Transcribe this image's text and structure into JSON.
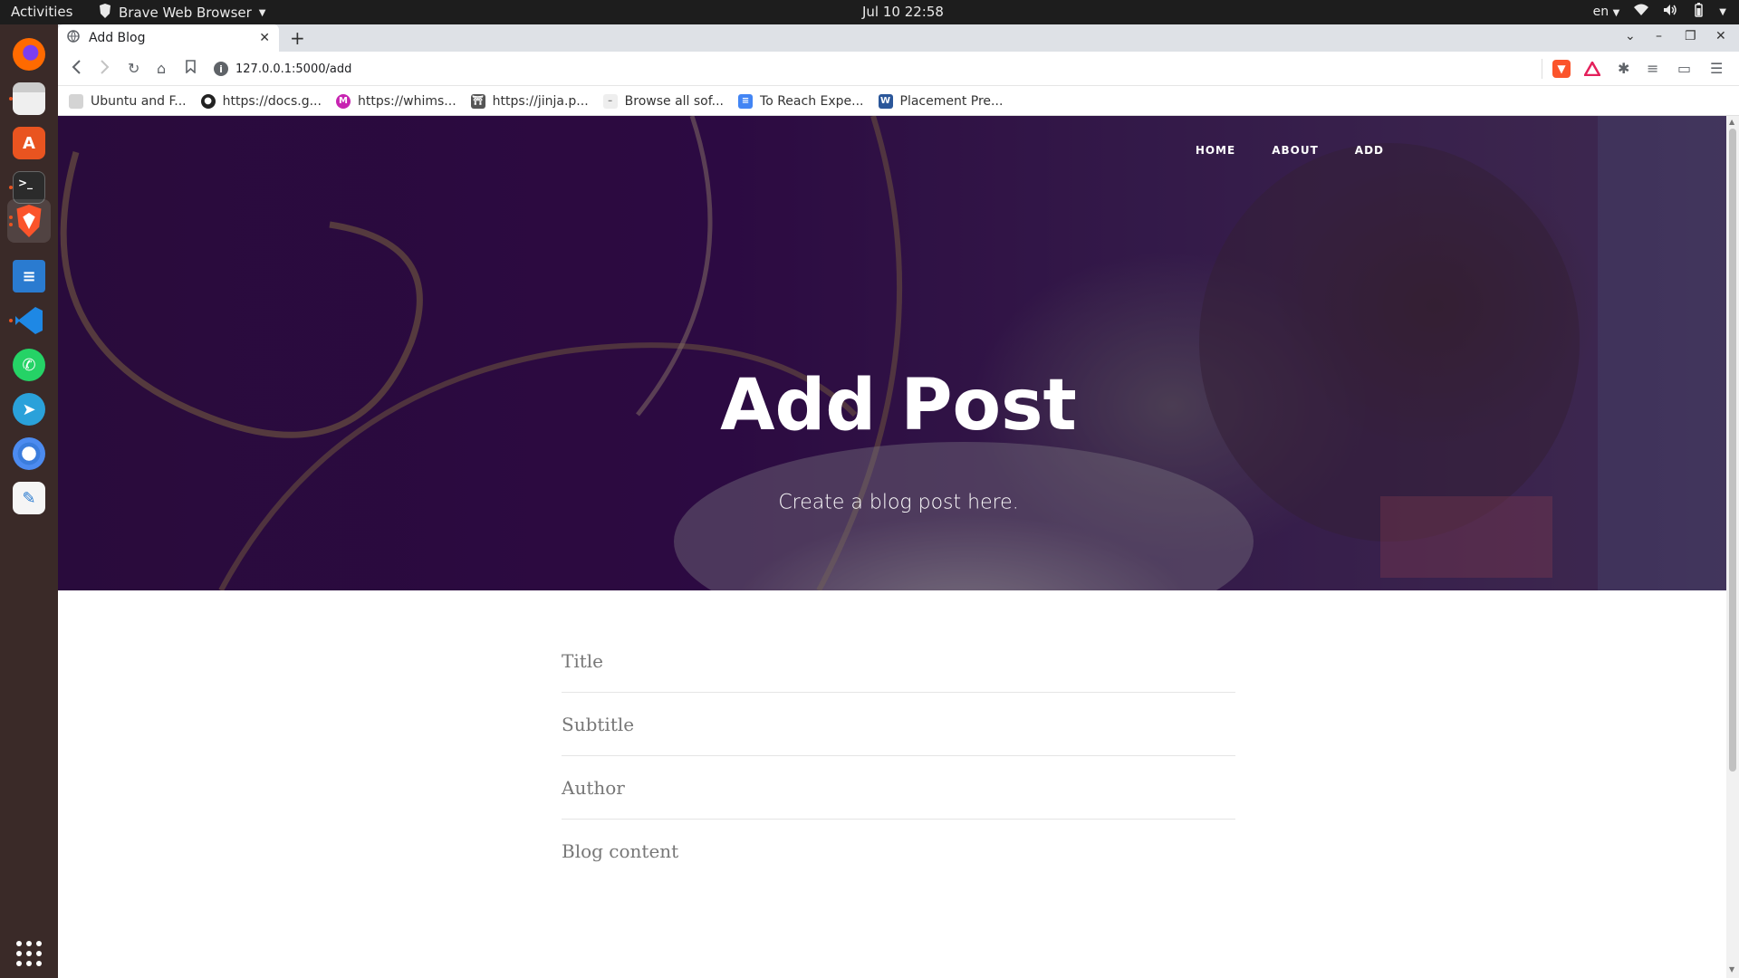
{
  "system": {
    "activities": "Activities",
    "app_name": "Brave Web Browser",
    "clock": "Jul 10  22:58",
    "language": "en"
  },
  "dock": {
    "items": [
      "firefox-icon",
      "files-icon",
      "software-center-icon",
      "terminal-icon",
      "brave-icon",
      "libreoffice-writer-icon",
      "vscode-icon",
      "whatsapp-icon",
      "telegram-icon",
      "chromium-icon",
      "text-editor-icon",
      "show-apps-icon"
    ]
  },
  "browser": {
    "tab_title": "Add Blog",
    "url": "127.0.0.1:5000/add",
    "bookmarks": [
      {
        "label": "Ubuntu and F...",
        "icon": "folder-icon"
      },
      {
        "label": "https://docs.g...",
        "icon": "github-icon"
      },
      {
        "label": "https://whims...",
        "icon": "whimsical-icon"
      },
      {
        "label": "https://jinja.p...",
        "icon": "jinja-icon"
      },
      {
        "label": "Browse all sof...",
        "icon": "page-icon"
      },
      {
        "label": "To Reach Expe...",
        "icon": "google-docs-icon"
      },
      {
        "label": "Placement Pre...",
        "icon": "word-icon"
      }
    ]
  },
  "site": {
    "nav": {
      "home": "HOME",
      "about": "ABOUT",
      "add": "ADD"
    },
    "hero_title": "Add Post",
    "hero_subtitle": "Create a blog post here.",
    "form": {
      "title_placeholder": "Title",
      "subtitle_placeholder": "Subtitle",
      "author_placeholder": "Author",
      "content_placeholder": "Blog content"
    }
  },
  "colors": {
    "ubuntu_accent": "#e95420",
    "hero_tint": "#2f0c45"
  }
}
